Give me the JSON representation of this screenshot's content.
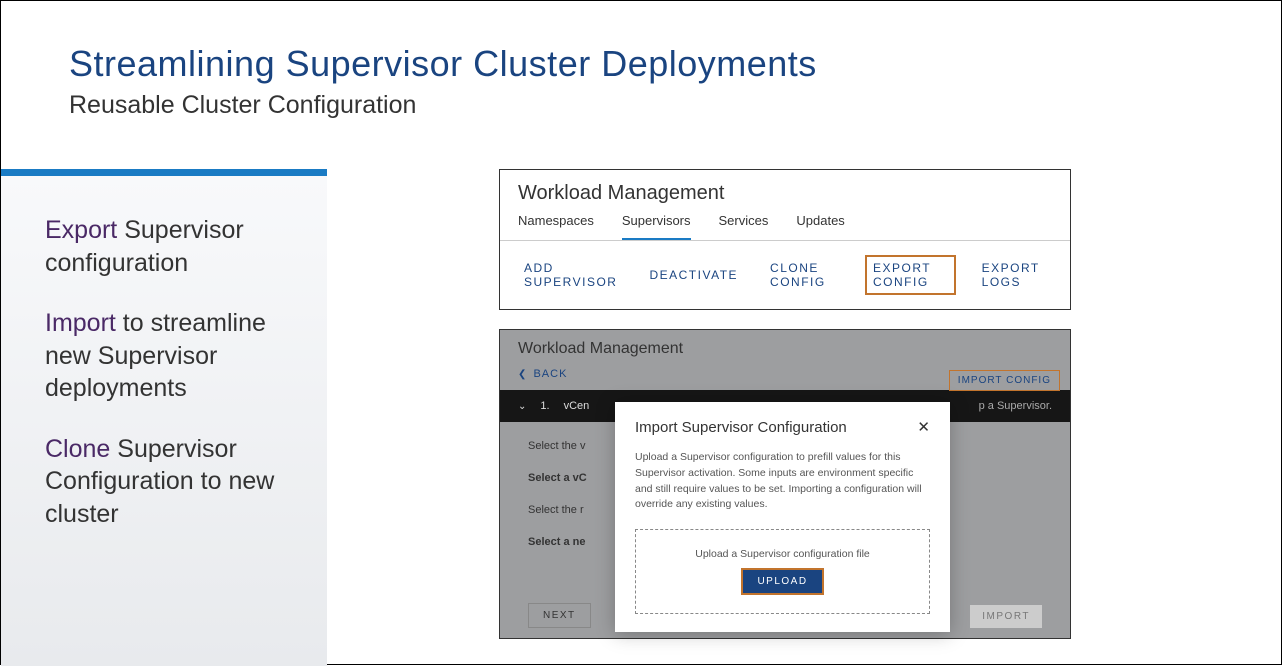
{
  "header": {
    "title": "Streamlining Supervisor Cluster Deployments",
    "subtitle": "Reusable Cluster Configuration"
  },
  "sidebar": {
    "items": [
      {
        "keyword": "Export",
        "rest": " Supervisor configuration"
      },
      {
        "keyword": "Import",
        "rest": " to streamline new Supervisor deployments"
      },
      {
        "keyword": "Clone",
        "rest": " Supervisor Configuration to new cluster"
      }
    ]
  },
  "topPanel": {
    "title": "Workload Management",
    "tabs": [
      "Namespaces",
      "Supervisors",
      "Services",
      "Updates"
    ],
    "activeTab": 1,
    "actions": [
      "ADD SUPERVISOR",
      "DEACTIVATE",
      "CLONE CONFIG",
      "EXPORT CONFIG",
      "EXPORT LOGS"
    ],
    "highlightedAction": 3
  },
  "bottomPanel": {
    "title": "Workload Management",
    "back": "BACK",
    "importConfig": "IMPORT CONFIG",
    "darkBar": {
      "num": "1.",
      "label": "vCen",
      "right": "p a Supervisor."
    },
    "formLabels": [
      "Select the v",
      "Select a vC",
      "Select the r",
      "Select a ne"
    ],
    "nextBtn": "NEXT",
    "importBtn": "IMPORT"
  },
  "dialog": {
    "title": "Import Supervisor Configuration",
    "close": "✕",
    "desc": "Upload a Supervisor configuration to prefill values for this Supervisor activation. Some inputs are environment specific and still require values to be set. Importing a configuration will override any existing values.",
    "uploadText": "Upload a Supervisor configuration file",
    "uploadBtn": "UPLOAD"
  }
}
